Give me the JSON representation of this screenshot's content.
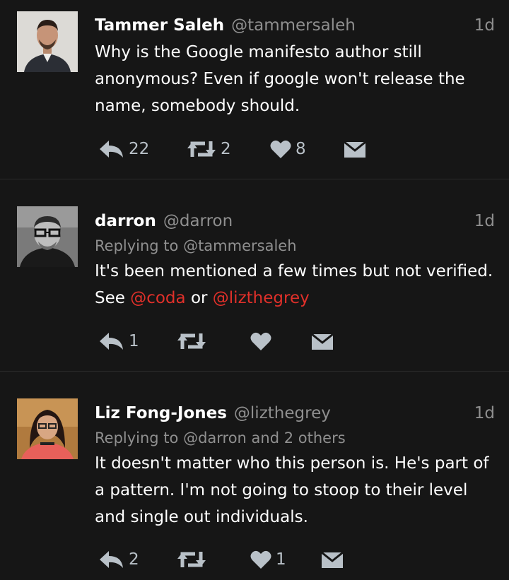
{
  "colors": {
    "background": "#161616",
    "text": "#ffffff",
    "muted": "#8f8f8f",
    "mention": "#e0302a",
    "icon": "#b9c1c8"
  },
  "tweets": [
    {
      "name": "Tammer Saleh",
      "handle": "@tammersaleh",
      "time": "1d",
      "replying": "",
      "text_parts": [
        "Why is the Google manifesto author still anonymous? Even if google won't release the name, somebody should."
      ],
      "reply_count": "22",
      "retweet_count": "2",
      "like_count": "8",
      "icons": [
        "reply-icon",
        "retweet-icon",
        "heart-icon",
        "envelope-icon"
      ]
    },
    {
      "name": "darron",
      "handle": "@darron",
      "time": "1d",
      "replying": "Replying to @tammersaleh",
      "text_parts": [
        "It's been mentioned a few times but not verified. See ",
        "@coda",
        " or ",
        "@lizthegrey"
      ],
      "reply_count": "1",
      "retweet_count": "",
      "like_count": "",
      "icons": [
        "reply-icon",
        "retweet-icon",
        "heart-icon",
        "envelope-icon"
      ]
    },
    {
      "name": "Liz Fong-Jones",
      "handle": "@lizthegrey",
      "time": "1d",
      "replying": "Replying to @darron and 2 others",
      "text_parts": [
        "It doesn't matter who this person is. He's part of a pattern. I'm not going to stoop to their level and single out individuals."
      ],
      "reply_count": "2",
      "retweet_count": "",
      "like_count": "1",
      "icons": [
        "reply-icon",
        "retweet-icon",
        "heart-icon",
        "envelope-icon"
      ]
    }
  ]
}
